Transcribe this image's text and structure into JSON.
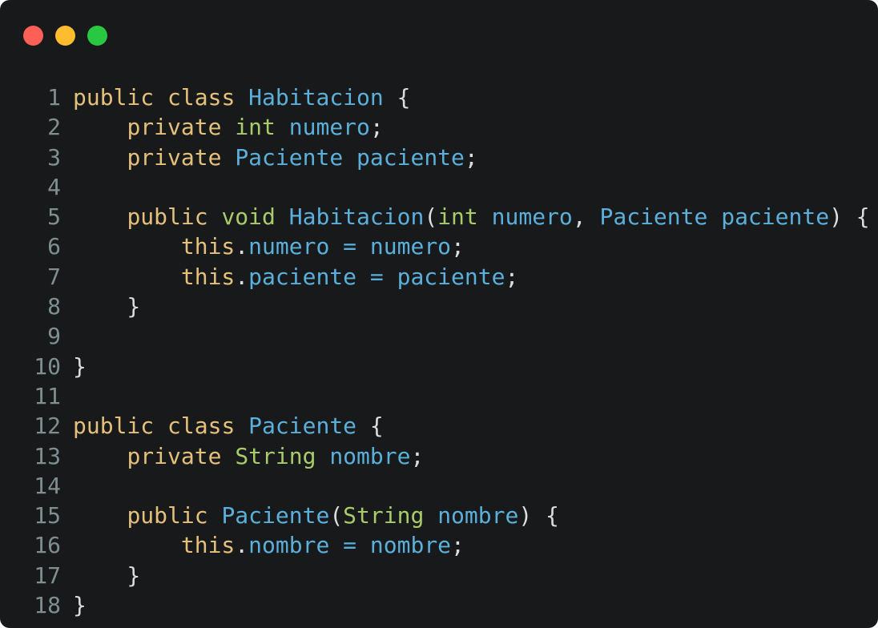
{
  "window": {
    "buttons": [
      "close",
      "minimize",
      "maximize"
    ],
    "colors": {
      "background": "#18191b",
      "close": "#fe5f57",
      "minimize": "#febc2e",
      "maximize": "#28c840",
      "line_number": "#7f8f91",
      "keyword": "#e5c07b",
      "type": "#a8cc6a",
      "identifier": "#5ab0db",
      "plain": "#dcdcdc"
    }
  },
  "code": {
    "language": "java",
    "lines": [
      {
        "n": "1",
        "tokens": [
          {
            "t": "kw",
            "v": "public"
          },
          {
            "t": "pl",
            "v": " "
          },
          {
            "t": "kw",
            "v": "class"
          },
          {
            "t": "pl",
            "v": " "
          },
          {
            "t": "id",
            "v": "Habitacion"
          },
          {
            "t": "pl",
            "v": " {"
          }
        ]
      },
      {
        "n": "2",
        "tokens": [
          {
            "t": "pl",
            "v": "    "
          },
          {
            "t": "kw",
            "v": "private"
          },
          {
            "t": "pl",
            "v": " "
          },
          {
            "t": "ty",
            "v": "int"
          },
          {
            "t": "pl",
            "v": " "
          },
          {
            "t": "id",
            "v": "numero"
          },
          {
            "t": "pl",
            "v": ";"
          }
        ]
      },
      {
        "n": "3",
        "tokens": [
          {
            "t": "pl",
            "v": "    "
          },
          {
            "t": "kw",
            "v": "private"
          },
          {
            "t": "pl",
            "v": " "
          },
          {
            "t": "id",
            "v": "Paciente"
          },
          {
            "t": "pl",
            "v": " "
          },
          {
            "t": "id",
            "v": "paciente"
          },
          {
            "t": "pl",
            "v": ";"
          }
        ]
      },
      {
        "n": "4",
        "tokens": []
      },
      {
        "n": "5",
        "tokens": [
          {
            "t": "pl",
            "v": "    "
          },
          {
            "t": "kw",
            "v": "public"
          },
          {
            "t": "pl",
            "v": " "
          },
          {
            "t": "ty",
            "v": "void"
          },
          {
            "t": "pl",
            "v": " "
          },
          {
            "t": "id",
            "v": "Habitacion"
          },
          {
            "t": "pl",
            "v": "("
          },
          {
            "t": "ty",
            "v": "int"
          },
          {
            "t": "pl",
            "v": " "
          },
          {
            "t": "id",
            "v": "numero"
          },
          {
            "t": "pl",
            "v": ", "
          },
          {
            "t": "id",
            "v": "Paciente"
          },
          {
            "t": "pl",
            "v": " "
          },
          {
            "t": "id",
            "v": "paciente"
          },
          {
            "t": "pl",
            "v": ") {"
          }
        ]
      },
      {
        "n": "6",
        "tokens": [
          {
            "t": "pl",
            "v": "        "
          },
          {
            "t": "kw",
            "v": "this"
          },
          {
            "t": "pl",
            "v": "."
          },
          {
            "t": "id",
            "v": "numero"
          },
          {
            "t": "pl",
            "v": " "
          },
          {
            "t": "id",
            "v": "="
          },
          {
            "t": "pl",
            "v": " "
          },
          {
            "t": "id",
            "v": "numero"
          },
          {
            "t": "pl",
            "v": ";"
          }
        ]
      },
      {
        "n": "7",
        "tokens": [
          {
            "t": "pl",
            "v": "        "
          },
          {
            "t": "kw",
            "v": "this"
          },
          {
            "t": "pl",
            "v": "."
          },
          {
            "t": "id",
            "v": "paciente"
          },
          {
            "t": "pl",
            "v": " "
          },
          {
            "t": "id",
            "v": "="
          },
          {
            "t": "pl",
            "v": " "
          },
          {
            "t": "id",
            "v": "paciente"
          },
          {
            "t": "pl",
            "v": ";"
          }
        ]
      },
      {
        "n": "8",
        "tokens": [
          {
            "t": "pl",
            "v": "    }"
          }
        ]
      },
      {
        "n": "9",
        "tokens": []
      },
      {
        "n": "10",
        "tokens": [
          {
            "t": "pl",
            "v": "}"
          }
        ]
      },
      {
        "n": "11",
        "tokens": []
      },
      {
        "n": "12",
        "tokens": [
          {
            "t": "kw",
            "v": "public"
          },
          {
            "t": "pl",
            "v": " "
          },
          {
            "t": "kw",
            "v": "class"
          },
          {
            "t": "pl",
            "v": " "
          },
          {
            "t": "id",
            "v": "Paciente"
          },
          {
            "t": "pl",
            "v": " {"
          }
        ]
      },
      {
        "n": "13",
        "tokens": [
          {
            "t": "pl",
            "v": "    "
          },
          {
            "t": "kw",
            "v": "private"
          },
          {
            "t": "pl",
            "v": " "
          },
          {
            "t": "ty",
            "v": "String"
          },
          {
            "t": "pl",
            "v": " "
          },
          {
            "t": "id",
            "v": "nombre"
          },
          {
            "t": "pl",
            "v": ";"
          }
        ]
      },
      {
        "n": "14",
        "tokens": []
      },
      {
        "n": "15",
        "tokens": [
          {
            "t": "pl",
            "v": "    "
          },
          {
            "t": "kw",
            "v": "public"
          },
          {
            "t": "pl",
            "v": " "
          },
          {
            "t": "id",
            "v": "Paciente"
          },
          {
            "t": "pl",
            "v": "("
          },
          {
            "t": "ty",
            "v": "String"
          },
          {
            "t": "pl",
            "v": " "
          },
          {
            "t": "id",
            "v": "nombre"
          },
          {
            "t": "pl",
            "v": ") {"
          }
        ]
      },
      {
        "n": "16",
        "tokens": [
          {
            "t": "pl",
            "v": "        "
          },
          {
            "t": "kw",
            "v": "this"
          },
          {
            "t": "pl",
            "v": "."
          },
          {
            "t": "id",
            "v": "nombre"
          },
          {
            "t": "pl",
            "v": " "
          },
          {
            "t": "id",
            "v": "="
          },
          {
            "t": "pl",
            "v": " "
          },
          {
            "t": "id",
            "v": "nombre"
          },
          {
            "t": "pl",
            "v": ";"
          }
        ]
      },
      {
        "n": "17",
        "tokens": [
          {
            "t": "pl",
            "v": "    }"
          }
        ]
      },
      {
        "n": "18",
        "tokens": [
          {
            "t": "pl",
            "v": "}"
          }
        ]
      }
    ]
  }
}
